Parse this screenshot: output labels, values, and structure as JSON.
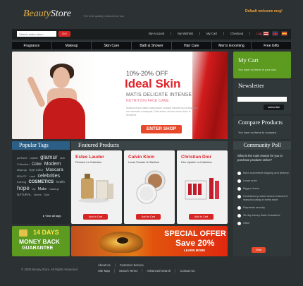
{
  "header": {
    "logo_beauty": "Beauty",
    "logo_store": "Store",
    "tagline": "The best quality products for you",
    "welcome": "Default welcome msg!",
    "search_placeholder": "Search entire store...",
    "search_button": "GO",
    "top_links": [
      "My Account",
      "My Wishlist",
      "My Cart",
      "Checkout",
      "Log In"
    ],
    "currencies": [
      "USD",
      "GBP",
      "EUR"
    ]
  },
  "nav": [
    "Fragrance",
    "Makeup",
    "Skin Care",
    "Bath & Shower",
    "Hair Care",
    "Men's Grooming",
    "Free Gifts"
  ],
  "banner": {
    "discount": "10%-20% OFF",
    "title": "Ideal Skin",
    "subtitle1": "MATIS DELICATE INTENSE",
    "subtitle2": "NUTRITION FACE CARE",
    "body": "Nostrud exerci tation ullamcorper suscipit lobortis nisl ut aliquip ex ea commodo consequat. Duis autem vel eum iriure dolor in hendrerit.",
    "button": "ENTER SHOP"
  },
  "cart": {
    "title": "My Cart",
    "text": "You have no items in your cart."
  },
  "newsletter": {
    "title": "Newsletter",
    "button": "subscribe"
  },
  "compare": {
    "title": "Compare Products",
    "text": "You have no items to compare."
  },
  "tags": {
    "title": "Popular Tags",
    "items": [
      "perfume",
      "Lipstick",
      "glamur",
      "skin",
      "Collection",
      "Color",
      "Modern",
      "Makeup",
      "Eye Color",
      "Mascara",
      "BEAUTY",
      "Lash",
      "celebrities",
      "training",
      "COSMETICS",
      "health",
      "hope",
      "My",
      "Make",
      "makeup",
      "NATURAL",
      "shoes",
      "Skin"
    ],
    "view_all": "View all tags"
  },
  "featured": {
    "title": "Featured Products",
    "products": [
      {
        "name": "Estee Lauder",
        "sub": "Perfume La Collection",
        "button": "Add to Cart"
      },
      {
        "name": "Calvin Klein",
        "sub": "Loose Powder 3rl Medium",
        "button": "Add to Cart"
      },
      {
        "name": "Christian Dior",
        "sub": "Dior Lipstick La Collection",
        "button": "Add to Cart"
      }
    ]
  },
  "poll": {
    "title": "Community Poll",
    "question": "What is the main reason for you to purchase products online?",
    "options": [
      "More convenient shipping and delivery",
      "Lower price",
      "Bigger choice",
      "Centralized product search instead of manual looking in every store",
      "Payments security",
      "30-day Money Back Guarantee",
      "Other"
    ],
    "vote": "Vote"
  },
  "promo": {
    "days": "14 DAYS",
    "money_back": "MONEY BACK",
    "guarantee": "GUARANTEE",
    "offer_title": "SPECIAL OFFER",
    "offer_save": "Save 20%",
    "offer_more": "LEARN MORE"
  },
  "footer": {
    "copyright": "© 2009 Beauty Store. All Rights Reserved.",
    "links_row1": [
      "About Us",
      "Customer Service"
    ],
    "links_row2": [
      "Site Map",
      "Search Terms",
      "Advanced Search",
      "Contact Us"
    ]
  }
}
